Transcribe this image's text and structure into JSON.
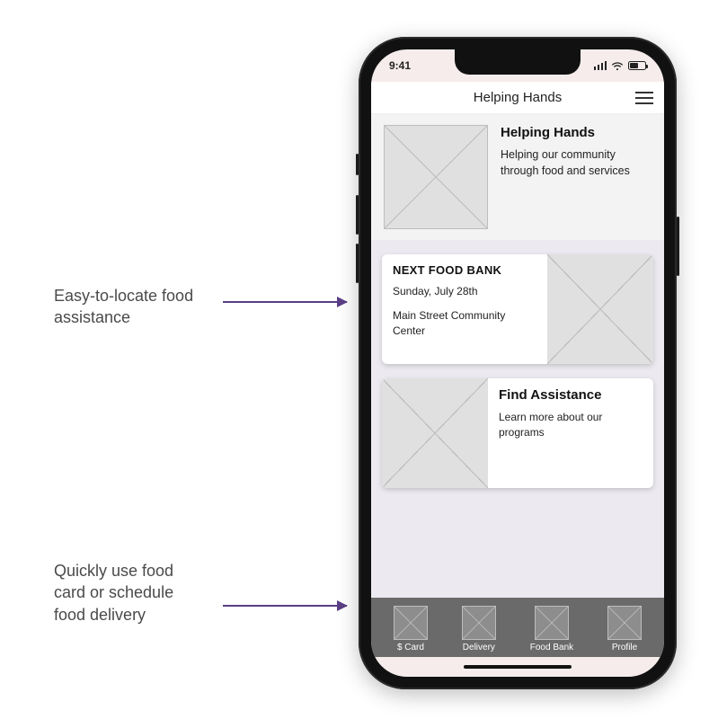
{
  "annotations": {
    "a1": "Easy-to-locate food assistance",
    "a2": "Quickly use food card or schedule food delivery"
  },
  "status": {
    "time": "9:41"
  },
  "app": {
    "title": "Helping Hands"
  },
  "hero": {
    "title": "Helping Hands",
    "subtitle": "Helping our community through food and services"
  },
  "next_food_bank": {
    "eyebrow": "NEXT FOOD BANK",
    "date": "Sunday, July 28th",
    "location": "Main Street Community Center"
  },
  "assist": {
    "title": "Find Assistance",
    "subtitle": "Learn more about our programs"
  },
  "nav": {
    "items": [
      {
        "label": "$ Card"
      },
      {
        "label": "Delivery"
      },
      {
        "label": "Food Bank"
      },
      {
        "label": "Profile"
      }
    ]
  }
}
